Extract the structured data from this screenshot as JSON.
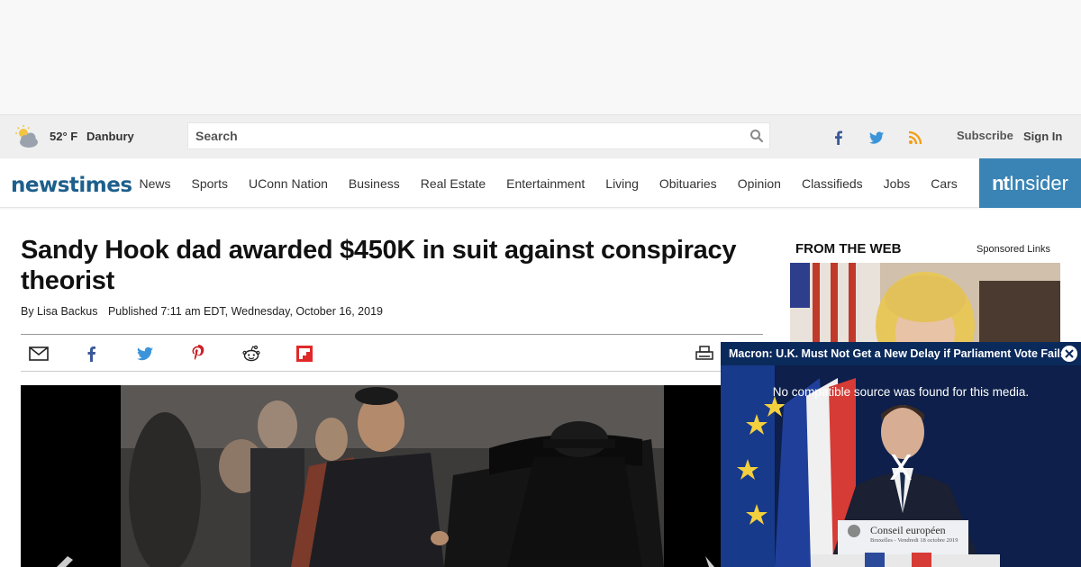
{
  "weather": {
    "temp": "52° F",
    "city": "Danbury",
    "icon": "partly-cloudy-icon"
  },
  "search": {
    "placeholder": "Search"
  },
  "account": {
    "subscribe": "Subscribe",
    "signin": "Sign In"
  },
  "social": {
    "facebook": "facebook-icon",
    "twitter": "twitter-icon",
    "rss": "rss-icon"
  },
  "brand": {
    "logo": "newstimes",
    "insider_prefix": "nt",
    "insider_suffix": "Insider",
    "color": "#1d5f8c",
    "insider_color": "#3a84b5"
  },
  "nav": {
    "items": [
      "News",
      "Sports",
      "UConn Nation",
      "Business",
      "Real Estate",
      "Entertainment",
      "Living",
      "Obituaries",
      "Opinion",
      "Classifieds",
      "Jobs",
      "Cars"
    ]
  },
  "article": {
    "headline": "Sandy Hook dad awarded $450K in suit against conspiracy theorist",
    "byline": "By Lisa Backus",
    "published": "Published 7:11 am EDT, Wednesday, October 16, 2019"
  },
  "share": {
    "icons": [
      "email-icon",
      "facebook-icon",
      "twitter-icon",
      "pinterest-icon",
      "reddit-icon",
      "flipboard-icon",
      "print-icon"
    ]
  },
  "sidebar": {
    "heading": "FROM THE WEB",
    "sponsored": "Sponsored Links"
  },
  "video": {
    "title": "Macron: U.K. Must Not Get a New Delay if Parliament Vote Fails",
    "message": "No compatible source was found for this media.",
    "close_glyph": "X",
    "podium_title": "Conseil européen",
    "podium_subtitle": "Bruxelles - Vendredi 18 octobre 2019"
  }
}
